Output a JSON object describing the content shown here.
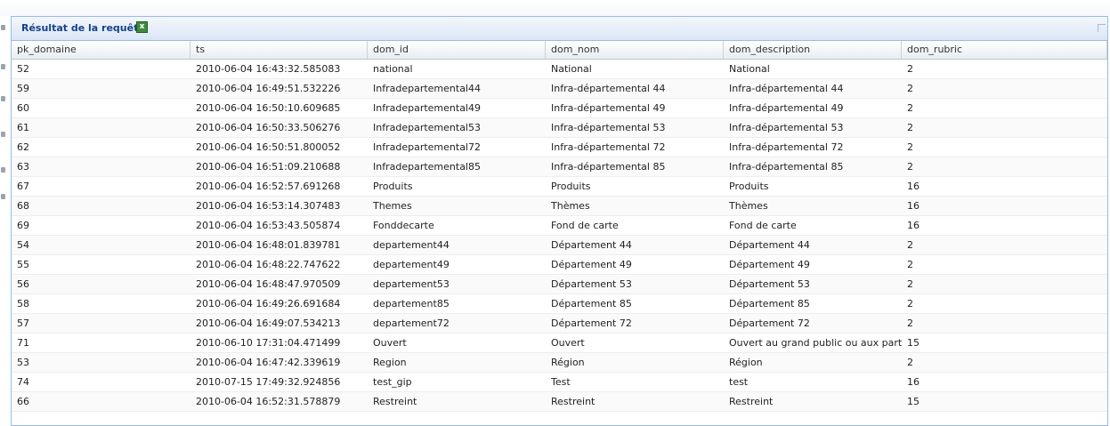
{
  "panel": {
    "title": "Résultat de la requête",
    "export_icon": "excel-icon"
  },
  "grid": {
    "columns": [
      "pk_domaine",
      "ts",
      "dom_id",
      "dom_nom",
      "dom_description",
      "dom_rubric"
    ],
    "rows": [
      [
        "52",
        "2010-06-04 16:43:32.585083",
        "national",
        "National",
        "National",
        "2"
      ],
      [
        "59",
        "2010-06-04 16:49:51.532226",
        "Infradepartemental44",
        "Infra-départemental 44",
        "Infra-départemental 44",
        "2"
      ],
      [
        "60",
        "2010-06-04 16:50:10.609685",
        "Infradepartemental49",
        "Infra-départemental 49",
        "Infra-départemental 49",
        "2"
      ],
      [
        "61",
        "2010-06-04 16:50:33.506276",
        "Infradepartemental53",
        "Infra-départemental 53",
        "Infra-départemental 53",
        "2"
      ],
      [
        "62",
        "2010-06-04 16:50:51.800052",
        "Infradepartemental72",
        "Infra-départemental 72",
        "Infra-départemental 72",
        "2"
      ],
      [
        "63",
        "2010-06-04 16:51:09.210688",
        "Infradepartemental85",
        "Infra-départemental 85",
        "Infra-départemental 85",
        "2"
      ],
      [
        "67",
        "2010-06-04 16:52:57.691268",
        "Produits",
        "Produits",
        "Produits",
        "16"
      ],
      [
        "68",
        "2010-06-04 16:53:14.307483",
        "Themes",
        "Thèmes",
        "Thèmes",
        "16"
      ],
      [
        "69",
        "2010-06-04 16:53:43.505874",
        "Fonddecarte",
        "Fond de carte",
        "Fond de carte",
        "16"
      ],
      [
        "54",
        "2010-06-04 16:48:01.839781",
        "departement44",
        "Département 44",
        "Département 44",
        "2"
      ],
      [
        "55",
        "2010-06-04 16:48:22.747622",
        "departement49",
        "Département 49",
        "Département 49",
        "2"
      ],
      [
        "56",
        "2010-06-04 16:48:47.970509",
        "departement53",
        "Département 53",
        "Département 53",
        "2"
      ],
      [
        "58",
        "2010-06-04 16:49:26.691684",
        "departement85",
        "Département 85",
        "Département 85",
        "2"
      ],
      [
        "57",
        "2010-06-04 16:49:07.534213",
        "departement72",
        "Département 72",
        "Département 72",
        "2"
      ],
      [
        "71",
        "2010-06-10 17:31:04.471499",
        "Ouvert",
        "Ouvert",
        "Ouvert au grand public ou aux partena",
        "15"
      ],
      [
        "53",
        "2010-06-04 16:47:42.339619",
        "Region",
        "Région",
        "Région",
        "2"
      ],
      [
        "74",
        "2010-07-15 17:49:32.924856",
        "test_gip",
        "Test",
        "test",
        "16"
      ],
      [
        "66",
        "2010-06-04 16:52:31.578879",
        "Restreint",
        "Restreint",
        "Restreint",
        "15"
      ]
    ]
  }
}
